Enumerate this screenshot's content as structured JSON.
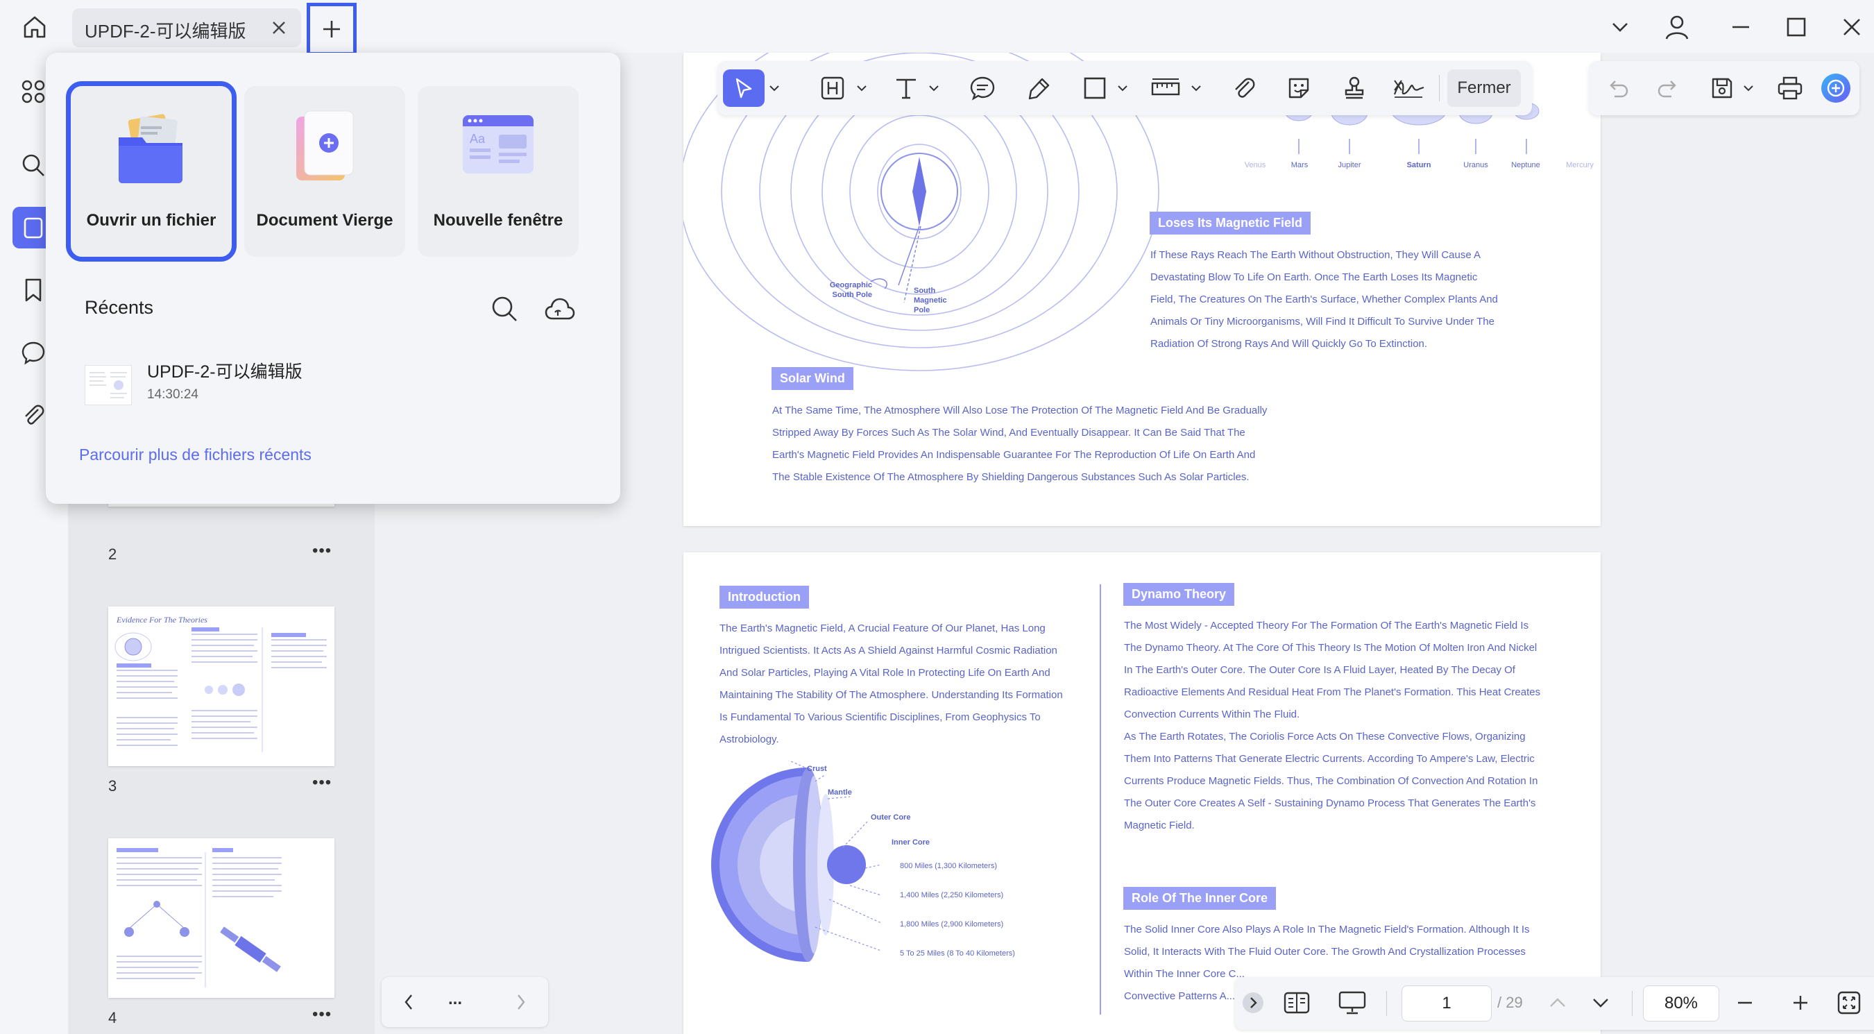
{
  "tab": {
    "title": "UPDF-2-可以编辑版"
  },
  "toolbar": {
    "close_label": "Fermer"
  },
  "popover": {
    "cards": [
      {
        "label": "Ouvrir un fichier"
      },
      {
        "label": "Document Vierge"
      },
      {
        "label": "Nouvelle fenêtre"
      }
    ],
    "recent_title": "Récents",
    "recent_item": {
      "name": "UPDF-2-可以编辑版",
      "time": "14:30:24"
    },
    "more_link": "Parcourir plus de fichiers récents"
  },
  "thumbnails": {
    "pages": [
      {
        "num": "2"
      },
      {
        "num": "3",
        "heading": "Evidence For The Theories"
      },
      {
        "num": "4"
      }
    ]
  },
  "page1": {
    "planet_labels": [
      "Venus",
      "Mars",
      "Jupiter",
      "Saturn",
      "Uranus",
      "Neptune",
      "Mercury"
    ],
    "pole_left": [
      "Geographic",
      "South Pole"
    ],
    "pole_right": [
      "South",
      "Magnetic",
      "Pole"
    ],
    "loses_heading": "Loses Its Magnetic Field",
    "loses_lines": [
      "If These Rays Reach The Earth Without Obstruction, They Will Cause A",
      "Devastating Blow To Life On Earth. Once The Earth Loses Its Magnetic",
      "Field, The Creatures On The Earth's Surface, Whether Complex Plants And",
      "Animals Or Tiny Microorganisms, Will Find It Difficult To Survive Under The",
      "Radiation Of Strong Rays And Will Quickly Go To Extinction."
    ],
    "solar_heading": "Solar Wind",
    "solar_lines": [
      "At The Same Time, The Atmosphere Will Also Lose The Protection Of The Magnetic Field And Be Gradually",
      "Stripped Away By Forces Such As The Solar Wind, And Eventually Disappear. It Can Be Said That The",
      "Earth's Magnetic Field Provides An Indispensable Guarantee For The Reproduction Of Life On Earth And",
      "The Stable Existence Of The Atmosphere By Shielding Dangerous Substances Such As Solar Particles."
    ]
  },
  "page2": {
    "intro_heading": "Introduction",
    "intro_lines": [
      "The Earth's Magnetic Field, A Crucial Feature Of Our Planet, Has Long",
      "Intrigued Scientists. It Acts As A Shield Against Harmful Cosmic Radiation",
      "And Solar Particles, Playing A Vital Role In Protecting Life On Earth And",
      "Maintaining The Stability Of The Atmosphere. Understanding Its Formation",
      "Is Fundamental To Various Scientific Disciplines, From Geophysics To",
      "Astrobiology."
    ],
    "layers": [
      "Crust",
      "Mantle",
      "Outer Core",
      "Inner Core"
    ],
    "depths": [
      "800 Miles (1,300 Kilometers)",
      "1,400 Miles (2,250 Kilometers)",
      "1,800 Miles (2,900 Kilometers)",
      "5 To 25 Miles (8 To 40 Kilometers)"
    ],
    "dynamo_heading": "Dynamo Theory",
    "dynamo_lines": [
      "The Most Widely - Accepted Theory For The Formation Of The Earth's Magnetic Field Is",
      "The Dynamo Theory. At The Core Of This Theory Is The Motion Of Molten Iron And Nickel",
      "In The Earth's Outer Core. The Outer Core Is A Fluid Layer, Heated By The Decay Of",
      "Radioactive Elements And Residual Heat From The Planet's Formation. This Heat Creates",
      "Convection Currents Within The Fluid.",
      "As The Earth Rotates, The Coriolis Force Acts On These Convective Flows, Organizing",
      "Them Into Patterns That Generate Electric Currents. According To Ampere's Law, Electric",
      "Currents Produce Magnetic Fields. Thus, The Combination Of Convection And Rotation In",
      "The Outer Core Creates A Self - Sustaining Dynamo Process That Generates The Earth's",
      "Magnetic Field."
    ],
    "inner_heading": "Role Of The Inner Core",
    "inner_lines": [
      "The Solid Inner Core Also Plays A Role In The Magnetic Field's Formation. Although It Is",
      "Solid, It Interacts With The Fluid Outer Core. The Growth And Crystallization Processes",
      "Within The Inner Core C...",
      "Convective Patterns A..."
    ]
  },
  "bottombar": {
    "page_input": "1",
    "page_total": "/ 29",
    "zoom": "80%"
  },
  "pagenav": {
    "more": "..."
  }
}
